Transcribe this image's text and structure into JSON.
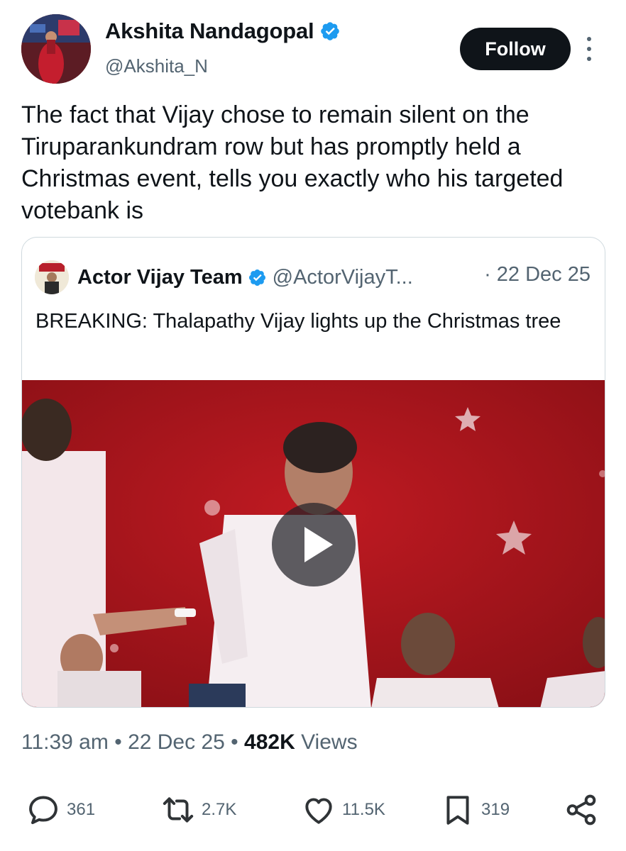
{
  "author": {
    "display_name": "Akshita Nandagopal",
    "handle": "@Akshita_N",
    "verified": true
  },
  "follow_label": "Follow",
  "tweet_text": "The fact that Vijay chose to remain silent on the Tiruparankundram row but has promptly held a Christmas event, tells you exactly who his targeted votebank is",
  "quoted": {
    "display_name": "Actor Vijay Team",
    "handle": "@ActorVijayT...",
    "date": "· 22 Dec 25",
    "text": "BREAKING: Thalapathy Vijay lights up the Christmas tree",
    "media_type": "video"
  },
  "meta": {
    "time": "11:39 am",
    "separator": "•",
    "date": "22 Dec 25",
    "views_count": "482K",
    "views_label": "Views"
  },
  "actions": {
    "replies": "361",
    "reposts": "2.7K",
    "likes": "11.5K",
    "bookmarks": "319"
  },
  "icons": {
    "verified": "verified-badge-icon",
    "more": "more-options-icon",
    "play": "play-icon",
    "reply": "reply-icon",
    "repost": "repost-icon",
    "like": "heart-icon",
    "bookmark": "bookmark-icon",
    "share": "share-icon"
  },
  "colors": {
    "verified_blue": "#1d9bf0",
    "text_primary": "#0f1419",
    "text_secondary": "#536471",
    "follow_bg": "#0f1419",
    "media_bg": "#a8141c"
  }
}
